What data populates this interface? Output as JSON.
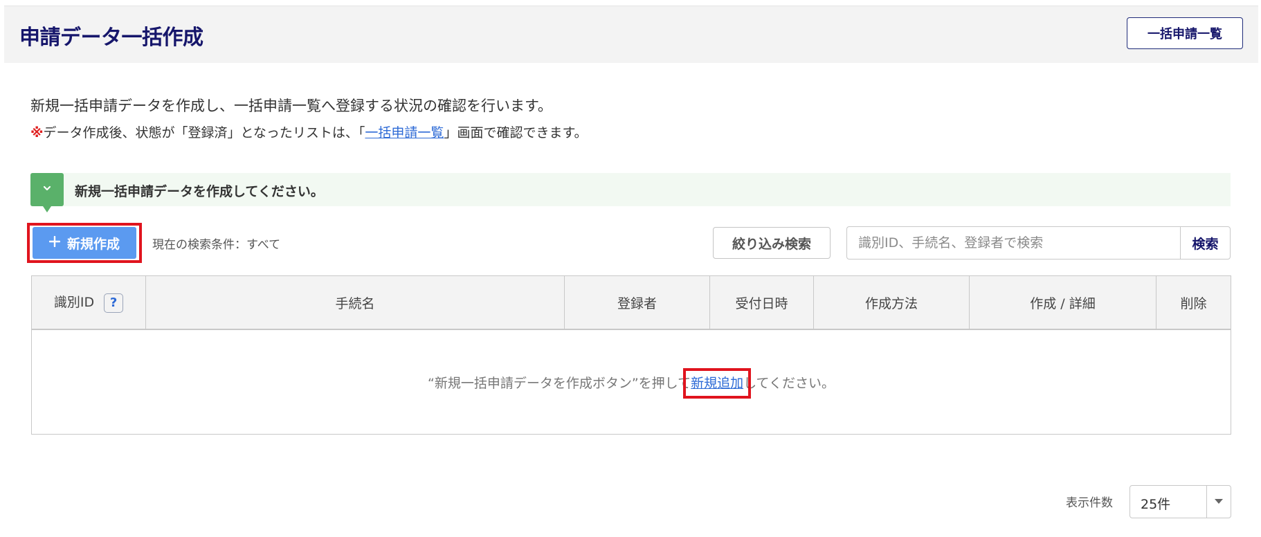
{
  "header": {
    "title": "申請データ一括作成",
    "list_button": "一括申請一覧"
  },
  "description": {
    "line1": "新規一括申請データを作成し、一括申請一覧へ登録する状況の確認を行います。",
    "note_mark": "※",
    "note_before": "データ作成後、状態が「登録済」となったリストは、「",
    "note_link": "一括申請一覧",
    "note_after": "」画面で確認できます。"
  },
  "notice": {
    "text": "新規一括申請データを作成してください。",
    "icon": "chevron-down-icon"
  },
  "toolbar": {
    "new_button": "新規作成",
    "new_icon": "plus-icon",
    "condition": "現在の検索条件：すべて",
    "filter_button": "絞り込み検索",
    "search_placeholder": "識別ID、手続名、登録者で検索",
    "search_button": "検索"
  },
  "table": {
    "columns": [
      "識別ID",
      "手続名",
      "登録者",
      "受付日時",
      "作成方法",
      "作成 / 詳細",
      "削除"
    ],
    "help_icon_label": "?",
    "empty_before": "“新規一括申請データを作成ボタン”を押して",
    "empty_link": "新規追加",
    "empty_after": "してください。"
  },
  "pagination": {
    "label": "表示件数",
    "per_page": "25件"
  },
  "colors": {
    "title": "#16166b",
    "accent_blue": "#5b9af0",
    "link": "#2d6ad6",
    "green": "#5ab16a",
    "highlight_red": "#e0141e"
  }
}
